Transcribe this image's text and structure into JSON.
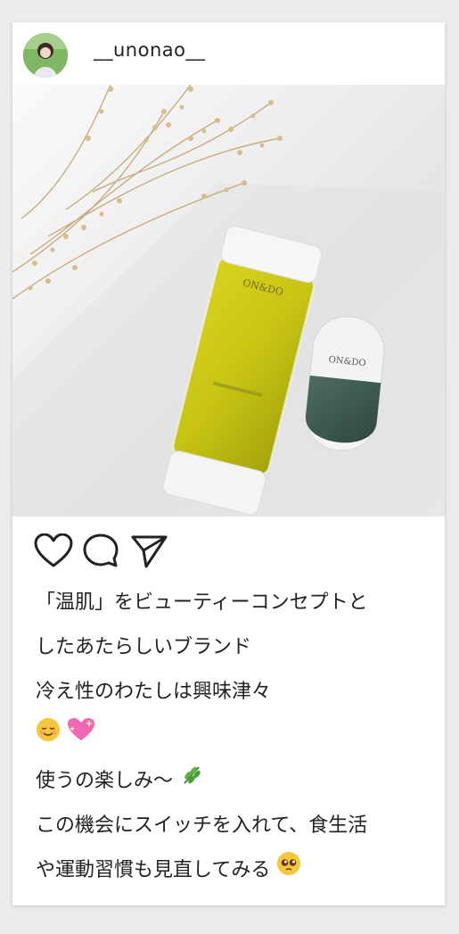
{
  "post": {
    "username": "__unonao__",
    "avatar_icon": "user-avatar",
    "photo_alt": "ON&DO skincare bottles with dried flowers",
    "actions": [
      "heart-icon",
      "comment-icon",
      "share-icon"
    ],
    "caption": {
      "line1": "「温肌」をビューティーコンセプトと",
      "line2": "したあたらしいブランド",
      "line3": "冷え性のわたしは興味津々",
      "line5": "使うの楽しみ〜",
      "line6": "この機会にスイッチを入れて、食生活",
      "line7": "や運動習慣も見直してみる"
    },
    "emojis": [
      "relieved-face",
      "sparkling-heart",
      "herb",
      "pleading-face"
    ]
  }
}
